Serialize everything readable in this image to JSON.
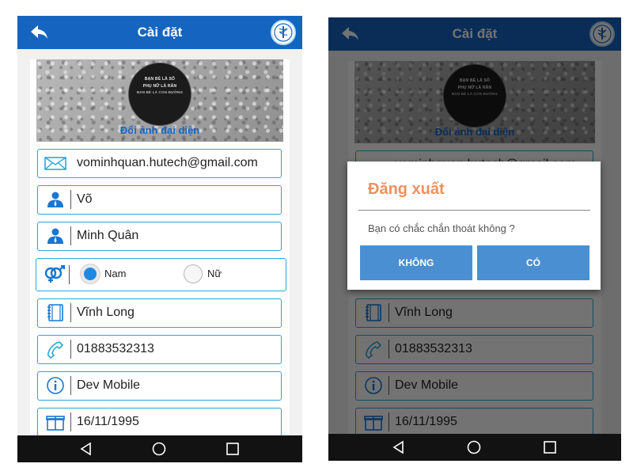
{
  "app": {
    "title": "Cài đặt"
  },
  "colors": {
    "appbar": "#1565c0",
    "field_border": "#2aa7d8",
    "dialog_title": "#f0905a",
    "dialog_button": "#4a8fd2"
  },
  "profile": {
    "avatar_lines": [
      "BẠN BÈ LÀ SỐ",
      "PHỤ NỮ LÀ RẮN",
      "BẠN BÈ LÀ CON ĐƯỜNG"
    ],
    "change_avatar_label": "Đổi ảnh đại diện"
  },
  "fields": {
    "email": "vominhquan.hutech@gmail.com",
    "last_name": "Võ",
    "first_name": "Minh Quân",
    "gender_male": "Nam",
    "gender_female": "Nữ",
    "gender_selected": "Nam",
    "city": "Vĩnh Long",
    "phone": "01883532313",
    "job": "Dev Mobile",
    "birthday": "16/11/1995"
  },
  "icons": {
    "back": "arrow-back-icon",
    "logo": "medical-logo-icon",
    "email": "envelope-icon",
    "person": "person-icon",
    "gender": "gender-icon",
    "city": "notebook-icon",
    "phone": "phone-icon",
    "job": "info-icon",
    "birthday": "gift-icon"
  },
  "dialog": {
    "title": "Đăng xuất",
    "message": "Bạn có chắc chắn thoát không ?",
    "cancel_label": "KHÔNG",
    "confirm_label": "CÓ"
  }
}
